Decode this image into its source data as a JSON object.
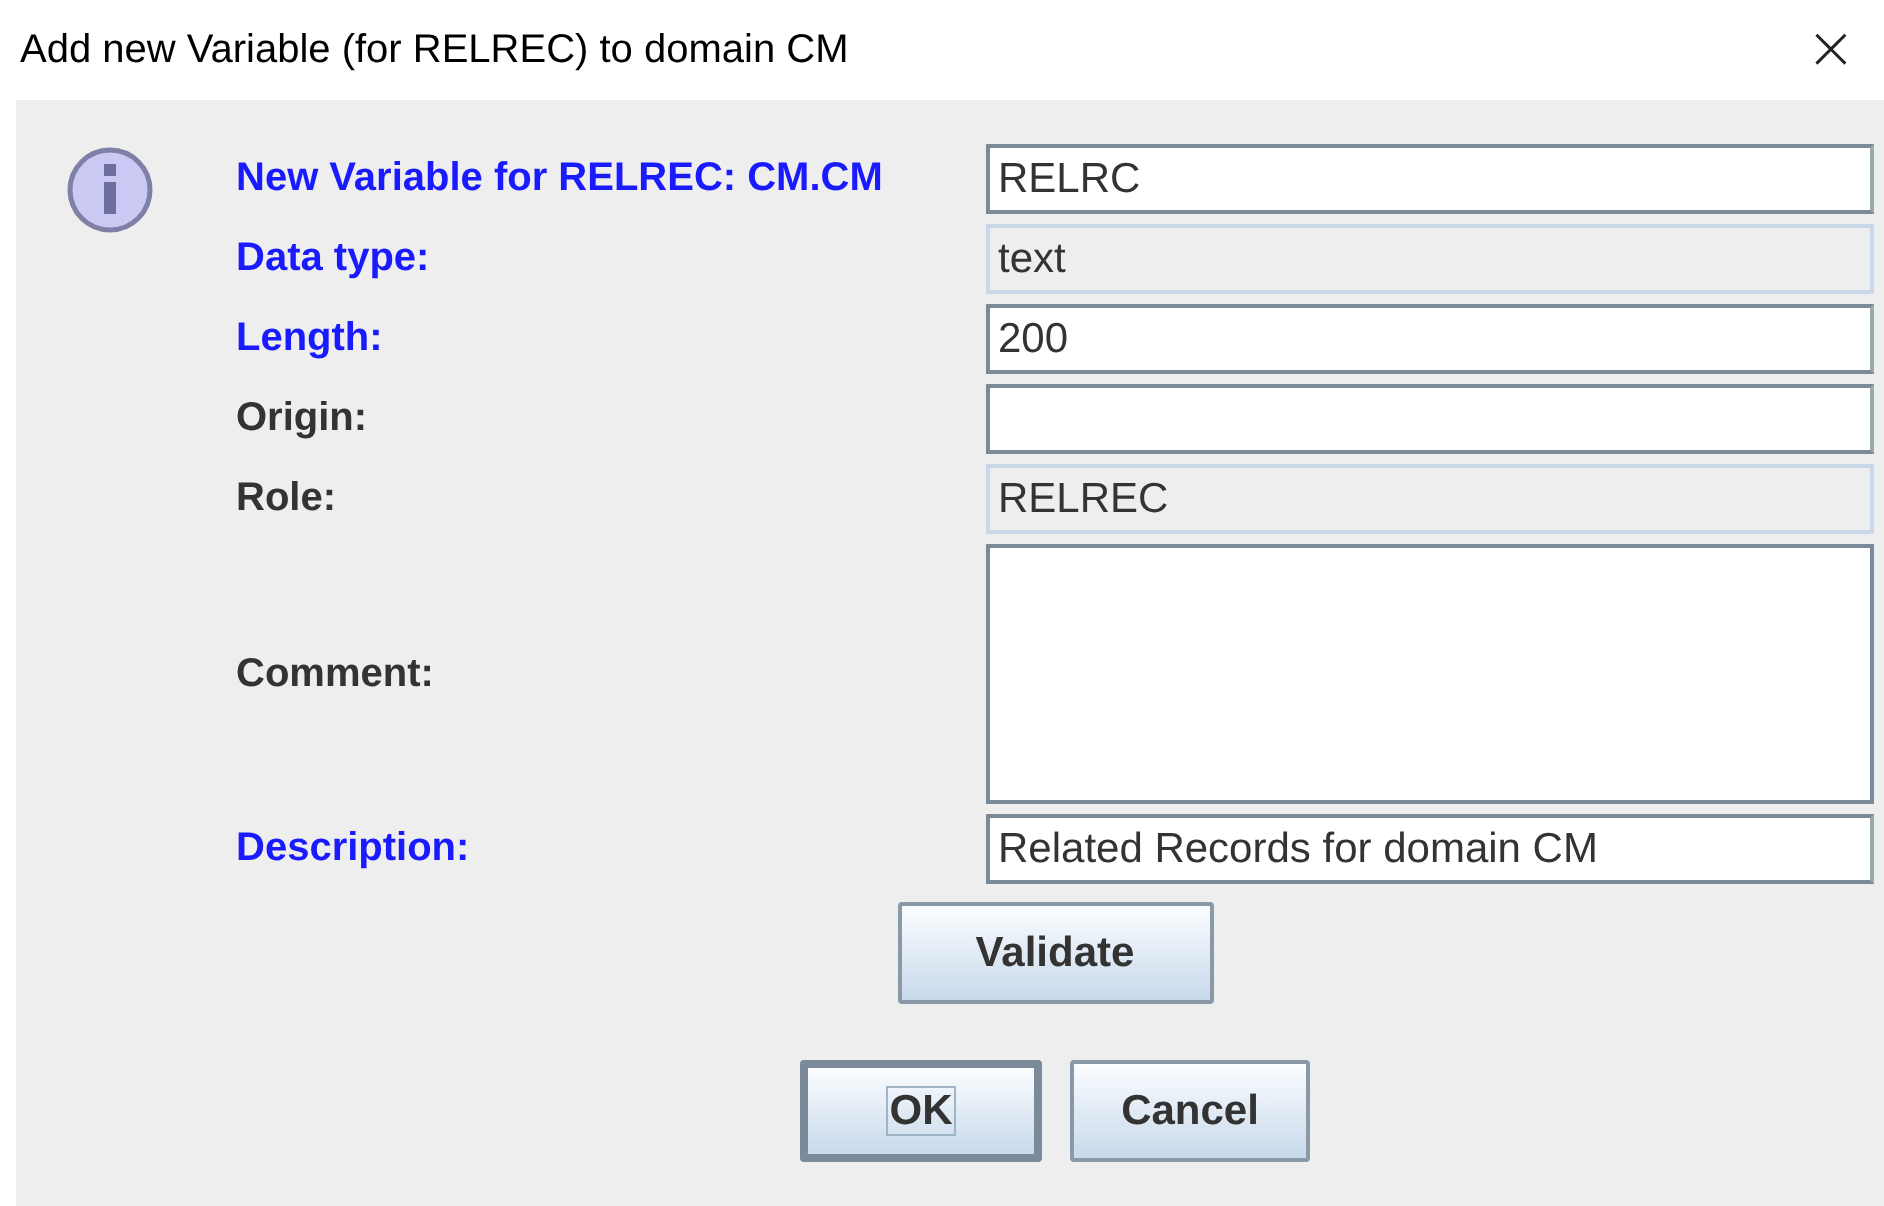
{
  "window": {
    "title": "Add new Variable (for RELREC) to domain CM",
    "close": "×"
  },
  "fields": [
    {
      "label": "New Variable for RELREC: CM.CM",
      "highlighted": true,
      "kind": "input",
      "value": "RELRC"
    },
    {
      "label": "Data type:",
      "highlighted": true,
      "kind": "readonly",
      "value": "text"
    },
    {
      "label": "Length:",
      "highlighted": true,
      "kind": "input",
      "value": "200"
    },
    {
      "label": "Origin:",
      "highlighted": false,
      "kind": "input"
    },
    {
      "label": "Role:",
      "highlighted": false,
      "kind": "readonly",
      "value": "RELREC"
    },
    {
      "label": "Comment:",
      "highlighted": false,
      "kind": "textarea"
    },
    {
      "label": "Description:",
      "highlighted": true,
      "kind": "input",
      "value": "Related Records for domain CM"
    }
  ],
  "validate_button": "Validate",
  "buttons": [
    {
      "label": "OK",
      "focused": true
    },
    {
      "label": "Cancel",
      "focused": false
    }
  ]
}
